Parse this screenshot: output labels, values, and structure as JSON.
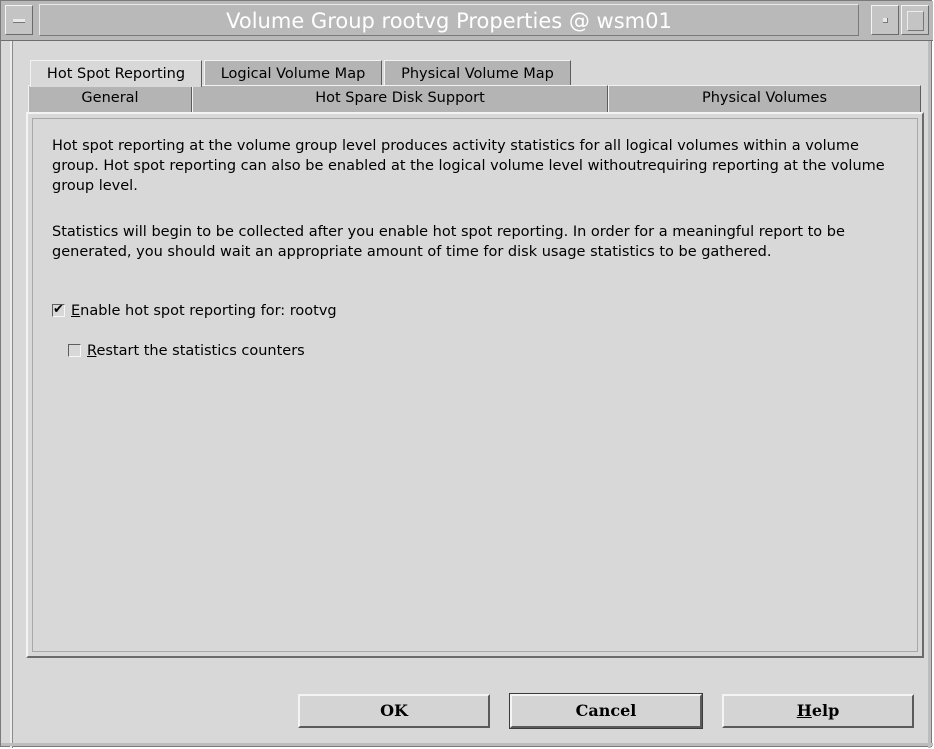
{
  "window": {
    "title": "Volume Group rootvg Properties @ wsm01"
  },
  "tabs": {
    "row1": [
      {
        "label": "Hot Spot Reporting",
        "active": true
      },
      {
        "label": "Logical Volume Map",
        "active": false
      },
      {
        "label": "Physical Volume Map",
        "active": false
      }
    ],
    "row2": [
      {
        "label": "General"
      },
      {
        "label": "Hot Spare Disk Support"
      },
      {
        "label": "Physical Volumes"
      }
    ]
  },
  "content": {
    "paragraph1": "Hot spot reporting at the volume group level produces activity statistics for all logical volumes within a volume group. Hot spot reporting can also be enabled at the logical volume level withoutrequiring reporting at the volume group level.",
    "paragraph2": "Statistics will begin to be collected after you enable hot spot reporting. In order for a meaningful report to be generated, you should wait an appropriate amount of time for disk usage statistics to be gathered.",
    "enable_checkbox": {
      "mnemonic": "E",
      "label_rest": "nable hot spot reporting for: rootvg",
      "checked": true,
      "mark": "✔"
    },
    "restart_checkbox": {
      "mnemonic": "R",
      "label_rest": "estart the statistics counters",
      "checked": false
    }
  },
  "buttons": {
    "ok": "OK",
    "cancel": "Cancel",
    "help_mnemonic": "H",
    "help_rest": "elp"
  },
  "colors": {
    "window_bg": "#d8d8d8",
    "title_bar": "#b9b9b9",
    "title_text": "#ffffff",
    "tab_inactive": "#b4b4b4"
  }
}
